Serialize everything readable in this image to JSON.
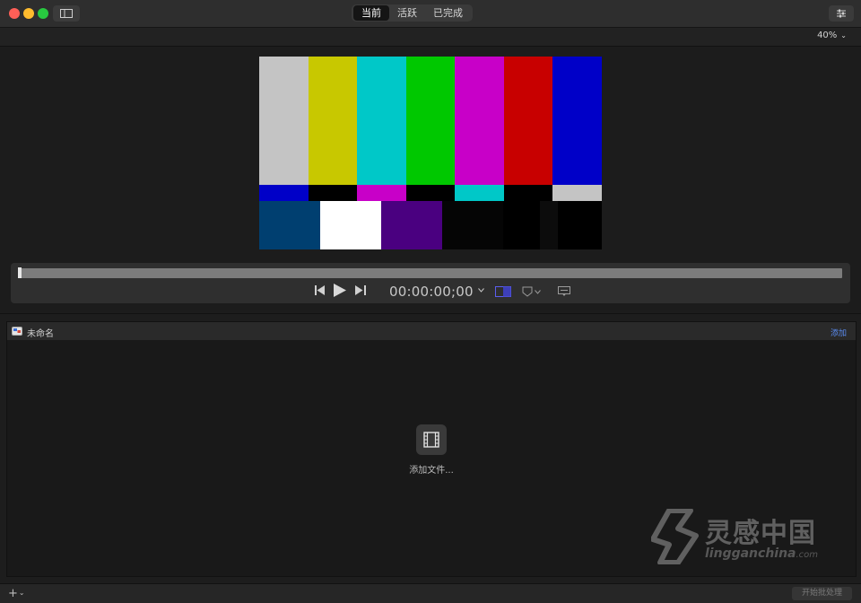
{
  "titlebar": {
    "tabs": [
      {
        "label": "当前",
        "active": true
      },
      {
        "label": "活跃",
        "active": false
      },
      {
        "label": "已完成",
        "active": false
      }
    ],
    "icons": {
      "sidebar": "sidebar-toggle-icon",
      "preferences": "sliders-icon"
    }
  },
  "viewer": {
    "zoom": "40%",
    "test_pattern": {
      "top_colors": [
        "#c4c4c4",
        "#c8c800",
        "#00c8c8",
        "#00c800",
        "#c800c8",
        "#c80000",
        "#0000c8"
      ],
      "middle_colors": [
        "#0000c8",
        "#000000",
        "#c800c8",
        "#000000",
        "#00c8c8",
        "#000000",
        "#c4c4c4"
      ],
      "bottom_colors": [
        "#003f70",
        "#ffffff",
        "#4a0080",
        "#050505",
        "#000000",
        "#0c0c0c",
        "#000000"
      ]
    }
  },
  "transport": {
    "timecode": "00:00:00;00",
    "icons": [
      "skip-back-icon",
      "play-icon",
      "skip-forward-icon",
      "timecode-chevron-icon",
      "viewer-layout-icon",
      "marker-icon",
      "marker-chevron-icon",
      "caption-icon"
    ]
  },
  "batch": {
    "name": "未命名",
    "add_label": "添加",
    "drop_label": "添加文件...",
    "icons": {
      "batch": "compressor-batch-icon",
      "drop": "film-icon"
    }
  },
  "watermark": {
    "cn": "灵感中国",
    "en": "lingganchina",
    "suffix": ".com"
  },
  "footer": {
    "add_menu": "+",
    "start_label": "开始批处理"
  },
  "colors": {
    "accent": "#5b8cf0",
    "background": "#1d1d1d"
  }
}
